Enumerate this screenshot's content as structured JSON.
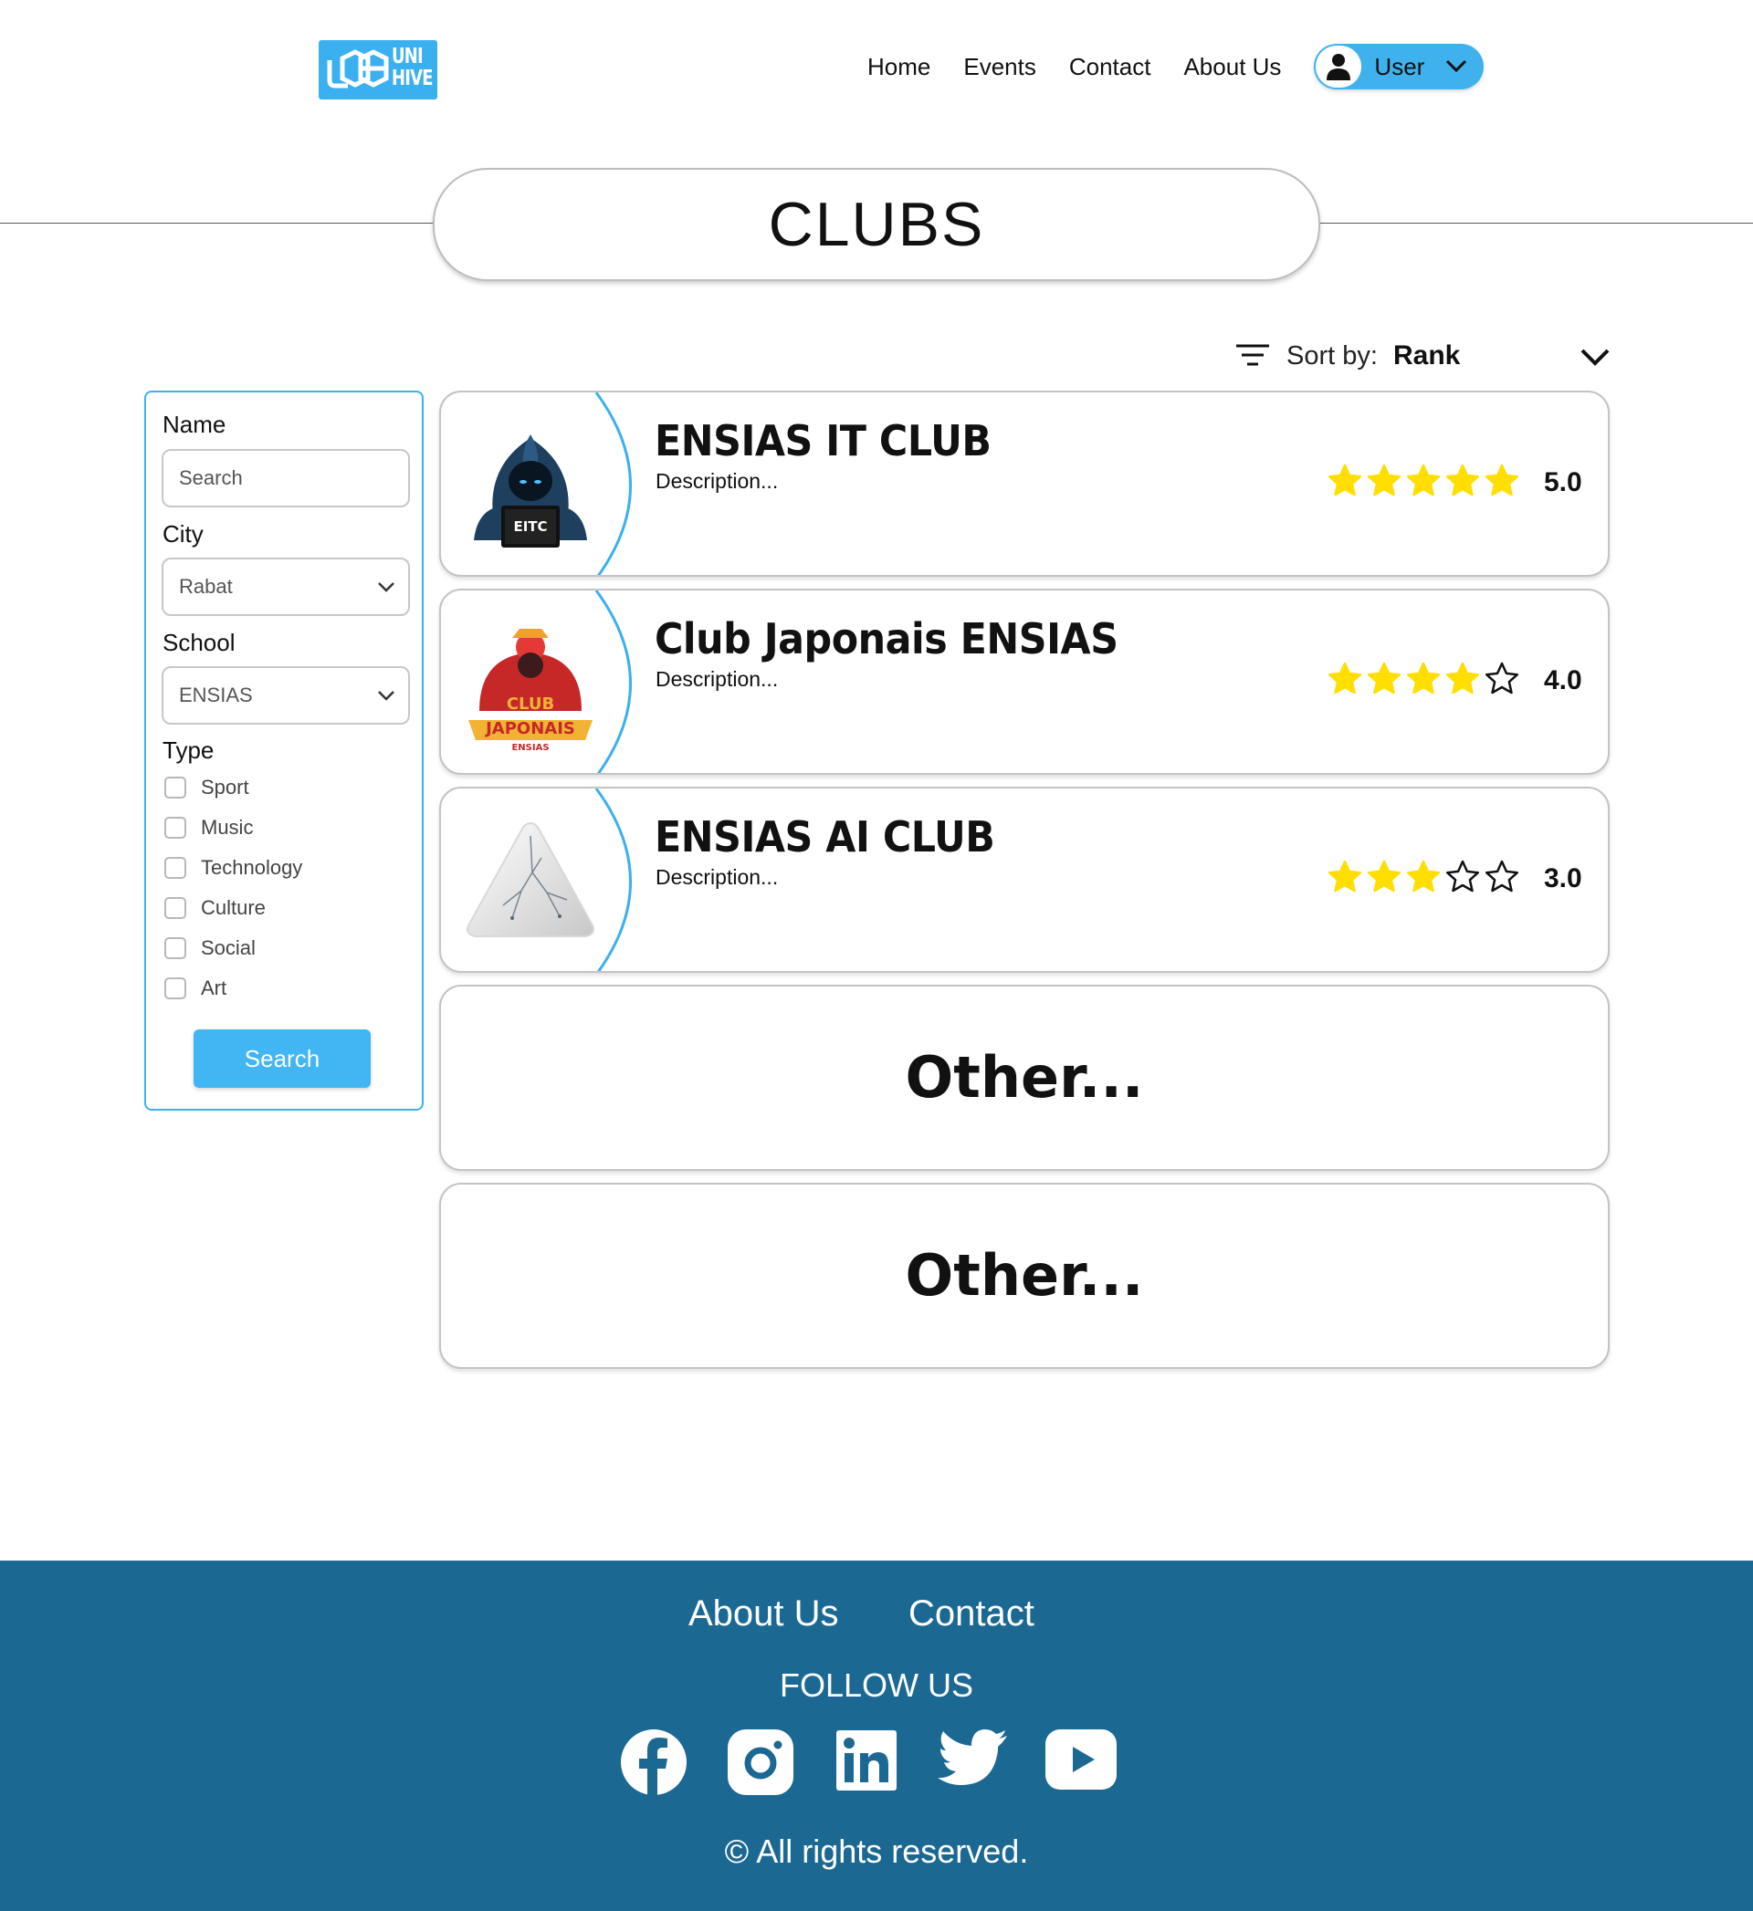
{
  "header": {
    "logo_text": "UNI HIVE",
    "nav": [
      "Home",
      "Events",
      "Contact",
      "About Us"
    ],
    "user_label": "User"
  },
  "page_title": "CLUBS",
  "sort": {
    "label": "Sort by:",
    "value": "Rank"
  },
  "filters": {
    "name_label": "Name",
    "name_placeholder": "Search",
    "city_label": "City",
    "city_value": "Rabat",
    "school_label": "School",
    "school_value": "ENSIAS",
    "type_label": "Type",
    "types": [
      "Sport",
      "Music",
      "Technology",
      "Culture",
      "Social",
      "Art"
    ],
    "search_button": "Search"
  },
  "clubs": [
    {
      "name": "ENSIAS IT CLUB",
      "description": "Description...",
      "stars": 5,
      "rating": "5.0",
      "logo_text": "EITC"
    },
    {
      "name": "Club Japonais ENSIAS",
      "description": "Description...",
      "stars": 4,
      "rating": "4.0",
      "logo_text": "CLUB JAPONAIS"
    },
    {
      "name": "ENSIAS AI CLUB",
      "description": "Description...",
      "stars": 3,
      "rating": "3.0",
      "logo_text": ""
    }
  ],
  "other_cards": [
    "Other...",
    "Other..."
  ],
  "footer": {
    "links": [
      "About Us",
      "Contact"
    ],
    "follow": "FOLLOW US",
    "social": [
      "facebook-icon",
      "instagram-icon",
      "linkedin-icon",
      "twitter-icon",
      "youtube-icon"
    ],
    "copyright": "© All rights reserved."
  },
  "colors": {
    "accent": "#3fb2ee",
    "footer": "#1b6893",
    "star": "#ffde00"
  }
}
